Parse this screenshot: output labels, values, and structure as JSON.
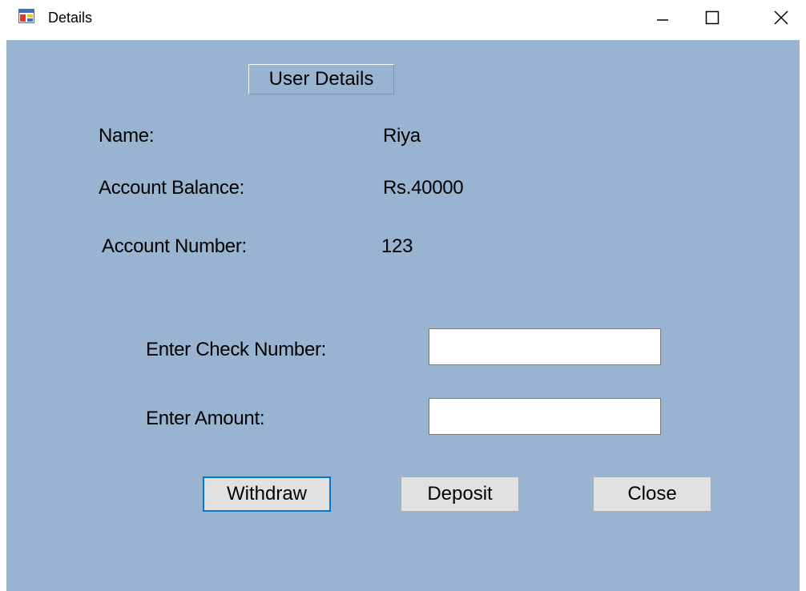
{
  "window": {
    "title": "Details",
    "icon": "winforms-app-icon",
    "controls": {
      "minimize": "minimize-icon",
      "maximize": "maximize-icon",
      "close": "close-icon"
    }
  },
  "form": {
    "group_title": "User Details",
    "name_label": "Name:",
    "name_value": "Riya",
    "balance_label": "Account Balance:",
    "balance_value": "Rs.40000",
    "account_label": "Account Number:",
    "account_value": "123",
    "check_label": "Enter Check Number:",
    "check_value": "",
    "amount_label": "Enter Amount:",
    "amount_value": ""
  },
  "buttons": {
    "withdraw": "Withdraw",
    "deposit": "Deposit",
    "close": "Close"
  },
  "colors": {
    "form_background": "#99b4d1",
    "focus_border": "#0078d7",
    "button_face": "#e1e1e1"
  }
}
